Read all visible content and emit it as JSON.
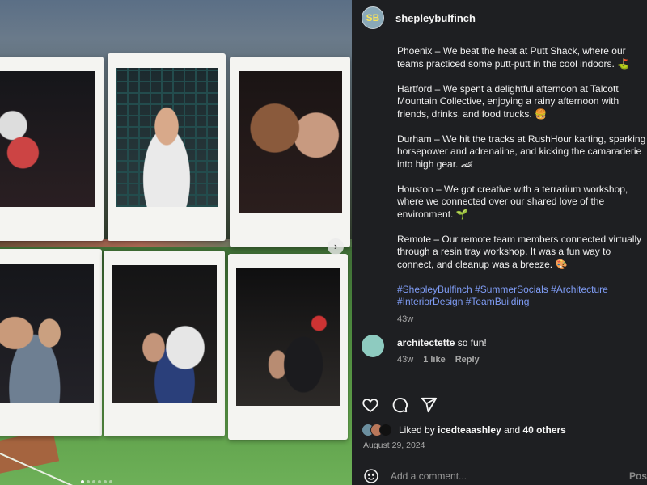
{
  "post": {
    "username": "shepleybulfinch",
    "avatar_text": "SB"
  },
  "caption": {
    "paragraphs": [
      "Phoenix – We beat the heat at Putt Shack, where our teams practiced some putt-putt in the cool indoors. ⛳",
      "Hartford – We spent a delightful afternoon at Talcott Mountain Collective, enjoying a rainy afternoon with friends, drinks, and food trucks. 🍔",
      "Durham – We hit the tracks at RushHour karting, sparking horsepower and adrenaline, and kicking the camaraderie into high gear. 🏎",
      "Houston – We got creative with a terrarium workshop, where we connected over our shared love of the environment. 🌱",
      "Remote – Our remote team members connected virtually through a resin tray workshop. It was a fun way to connect, and cleanup was a breeze. 🎨"
    ],
    "hashtags": "#ShepleyBulfinch #SummerSocials #Architecture #InteriorDesign #TeamBuilding",
    "time": "43w"
  },
  "comment": {
    "username": "architectette",
    "text": "so fun!",
    "time": "43w",
    "likes": "1 like",
    "reply": "Reply"
  },
  "actions": {
    "like_icon": "heart-icon",
    "comment_icon": "comment-icon",
    "share_icon": "share-icon"
  },
  "likes": {
    "prefix": "Liked by",
    "user": "icedteaashley",
    "middle": "and",
    "others": "40 others"
  },
  "date": "August 29, 2024",
  "add_comment": {
    "placeholder": "Add a comment...",
    "post_label": "Post"
  },
  "carousel": {
    "next_icon": "chevron-right-icon",
    "dot_count": 6,
    "active_dot": 1
  },
  "colors": {
    "background": "#1e1f22",
    "hashtag": "#7f9cf5",
    "muted": "#a8a8a8"
  }
}
